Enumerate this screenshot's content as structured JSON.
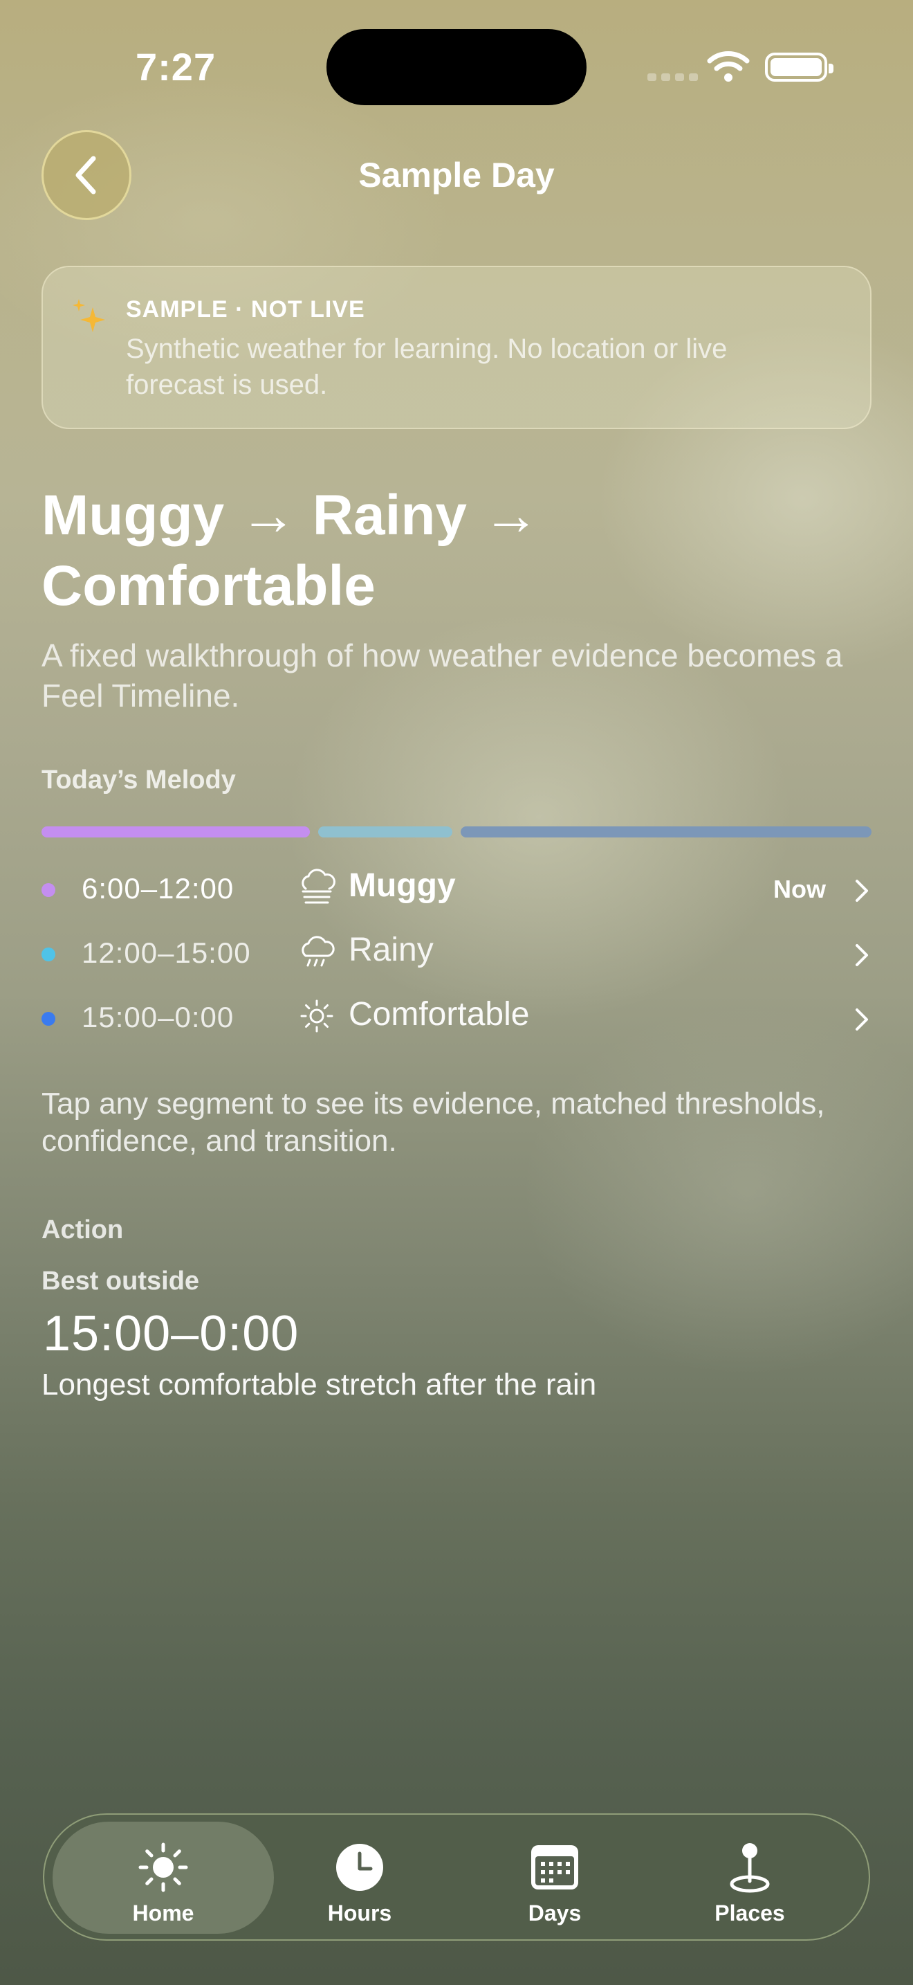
{
  "status_bar": {
    "time": "7:27"
  },
  "header": {
    "title": "Sample Day"
  },
  "sample_banner": {
    "title": "SAMPLE · NOT LIVE",
    "text": "Synthetic weather for learning. No location or live forecast is used.",
    "icon": "sparkles-icon",
    "icon_color": "#f5b836"
  },
  "hero": {
    "title": "Muggy → Rainy → Comfortable",
    "subtitle": "A fixed walkthrough of how weather evidence becomes a Feel Timeline."
  },
  "melody": {
    "label": "Today’s Melody",
    "segments": [
      {
        "time": "6:00–12:00",
        "feel": "Muggy",
        "icon": "cloud-haze-icon",
        "badge": "Now",
        "color": "#c48ef0",
        "share": 0.33
      },
      {
        "time": "12:00–15:00",
        "feel": "Rainy",
        "icon": "cloud-rain-icon",
        "badge": "",
        "color": "#8fc0cf",
        "share": 0.165
      },
      {
        "time": "15:00–0:00",
        "feel": "Comfortable",
        "icon": "sun-icon",
        "badge": "",
        "color": "#7c97b8",
        "share": 0.505
      }
    ],
    "dot_colors": [
      "#c48ef0",
      "#4fc3e8",
      "#3a7bef"
    ],
    "hint": "Tap any segment to see its evidence, matched thresholds, confidence, and transition."
  },
  "action": {
    "label": "Action",
    "best_label": "Best outside",
    "best_time": "15:00–0:00",
    "best_desc": "Longest comfortable stretch after the rain"
  },
  "tabs": [
    {
      "label": "Home",
      "icon": "sun-icon",
      "active": true
    },
    {
      "label": "Hours",
      "icon": "clock-icon",
      "active": false
    },
    {
      "label": "Days",
      "icon": "calendar-icon",
      "active": false
    },
    {
      "label": "Places",
      "icon": "map-pin-icon",
      "active": false
    }
  ]
}
